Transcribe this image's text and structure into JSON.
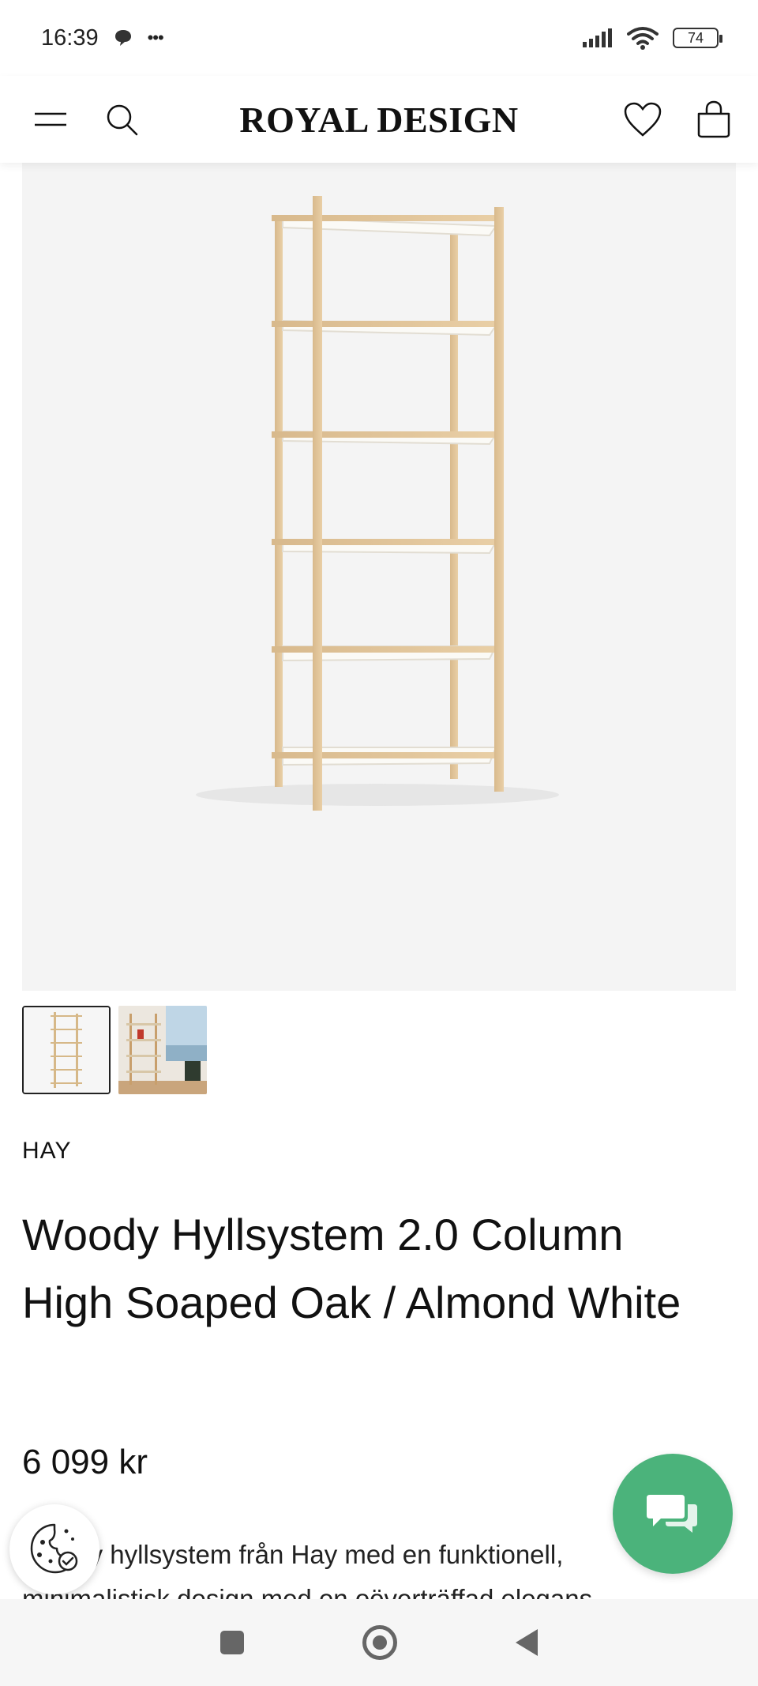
{
  "status_bar": {
    "time": "16:39",
    "dots": "•••",
    "battery": "74"
  },
  "header": {
    "logo": "ROYAL DESIGN"
  },
  "product": {
    "brand": "HAY",
    "title": "Woody Hyllsystem 2.0 Column High Soaped Oak / Almond White",
    "price": "6 099 kr",
    "description": "Woody hyllsystem från Hay med en funktionell, minimalistisk design med en oöverträffad elegans"
  },
  "icons": {
    "menu": "hamburger-menu-icon",
    "search": "search-icon",
    "wishlist": "heart-icon",
    "cart": "shopping-bag-icon",
    "chat": "chat-icon",
    "cookie": "cookie-icon"
  },
  "colors": {
    "chat_button": "#4bb37b",
    "image_bg": "#f4f4f4"
  }
}
